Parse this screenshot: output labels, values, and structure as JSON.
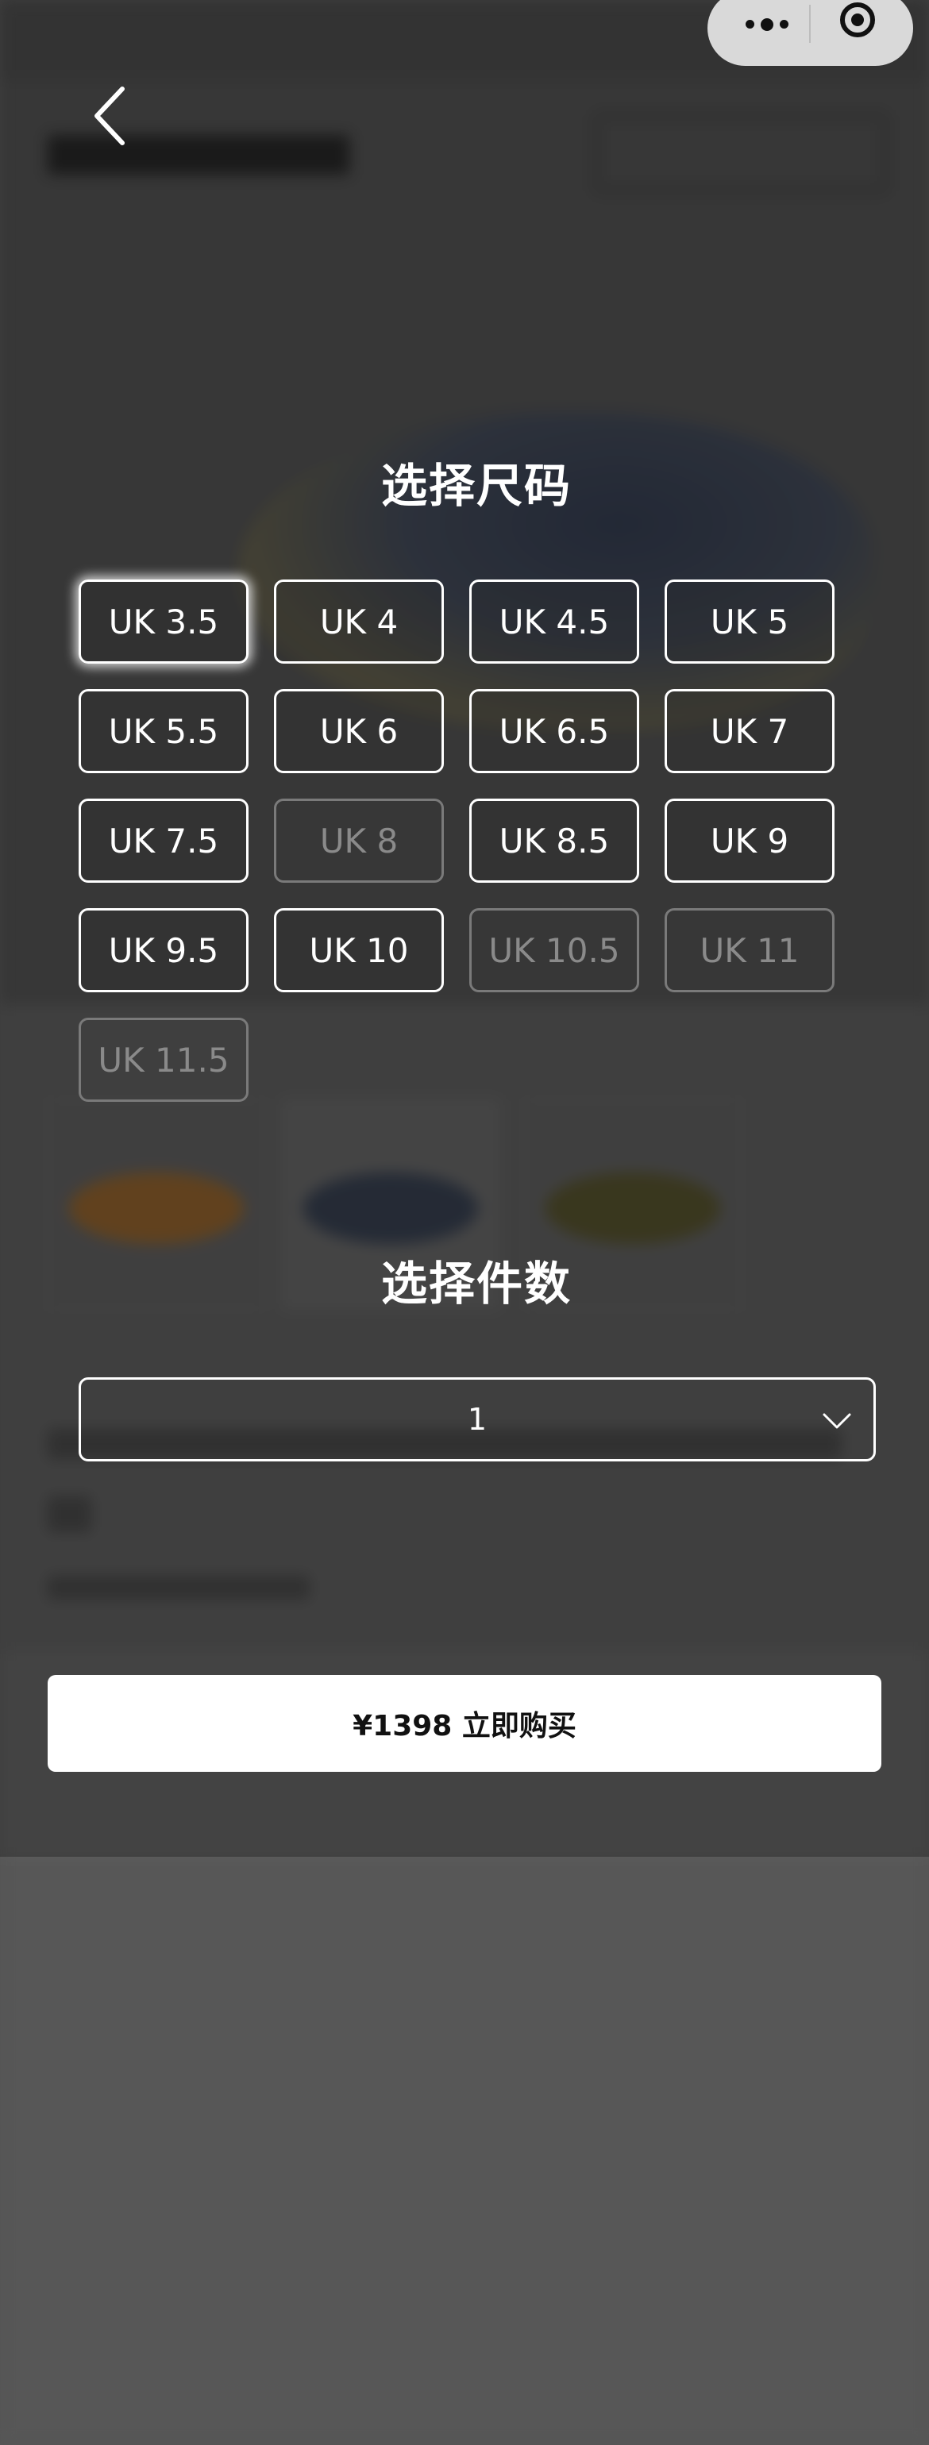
{
  "size_section": {
    "title": "选择尺码",
    "sizes": [
      {
        "label": "UK 3.5",
        "state": "selected"
      },
      {
        "label": "UK 4",
        "state": "available"
      },
      {
        "label": "UK 4.5",
        "state": "available"
      },
      {
        "label": "UK 5",
        "state": "available"
      },
      {
        "label": "UK 5.5",
        "state": "available"
      },
      {
        "label": "UK 6",
        "state": "available"
      },
      {
        "label": "UK 6.5",
        "state": "available"
      },
      {
        "label": "UK 7",
        "state": "available"
      },
      {
        "label": "UK 7.5",
        "state": "available"
      },
      {
        "label": "UK 8",
        "state": "disabled"
      },
      {
        "label": "UK 8.5",
        "state": "available"
      },
      {
        "label": "UK 9",
        "state": "available"
      },
      {
        "label": "UK 9.5",
        "state": "available"
      },
      {
        "label": "UK 10",
        "state": "available"
      },
      {
        "label": "UK 10.5",
        "state": "disabled"
      },
      {
        "label": "UK 11",
        "state": "disabled"
      },
      {
        "label": "UK 11.5",
        "state": "disabled"
      }
    ]
  },
  "quantity_section": {
    "title": "选择件数",
    "selected_value": "1"
  },
  "buy_button": {
    "label": "¥1398 立即购买"
  },
  "icons": {
    "back": "chevron-left-icon",
    "more": "more-dots-icon",
    "close_miniprogram": "target-circle-icon",
    "dropdown": "chevron-down-icon"
  },
  "colors": {
    "overlay_text": "#ffffff",
    "disabled_border": "#7a7a7a",
    "disabled_text": "#8a8a8a",
    "buy_button_bg": "#ffffff",
    "buy_button_text": "#111111"
  }
}
